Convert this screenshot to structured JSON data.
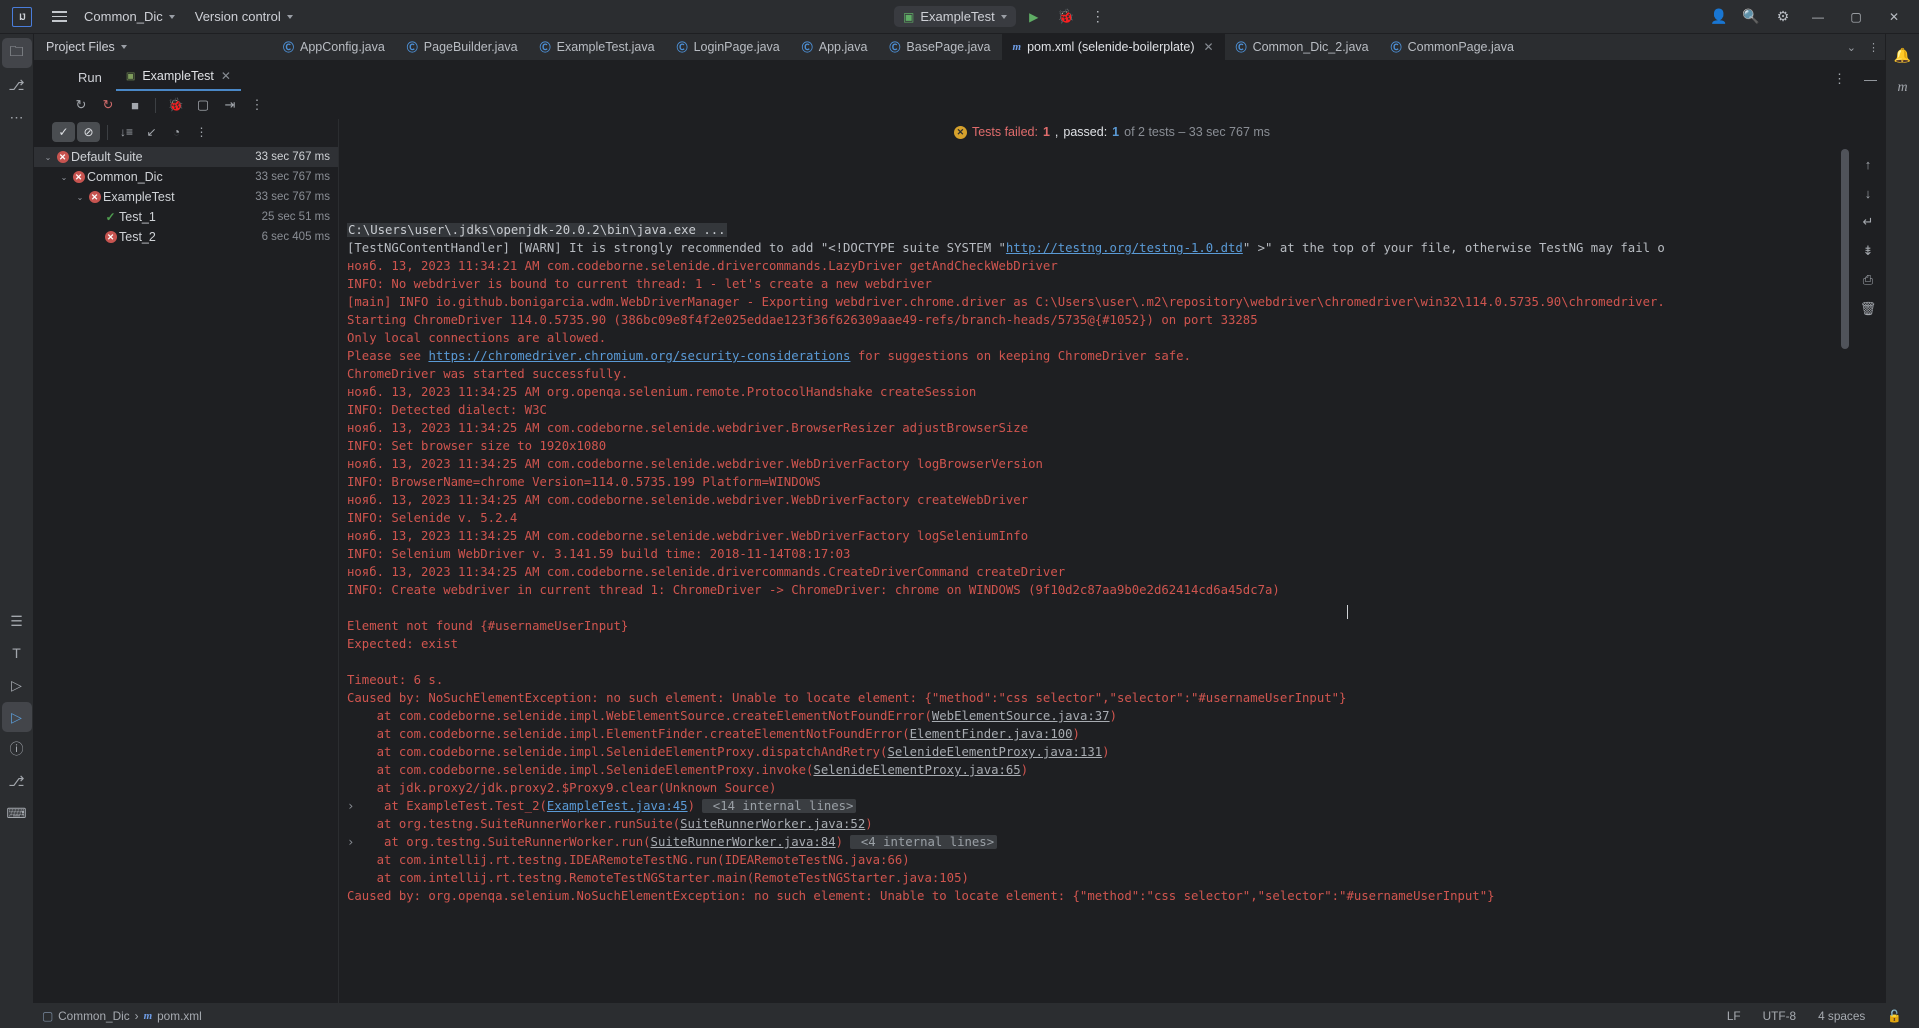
{
  "titlebar": {
    "logo": "IJ",
    "menu_icon": "hamburger-icon",
    "project": "Common_Dic",
    "vcs": "Version control",
    "run_config": "ExampleTest",
    "run_icon": "run-icon",
    "debug_icon": "debug-icon",
    "more_icon": "more-vertical-icon",
    "account_icon": "account-icon",
    "search_icon": "search-icon",
    "settings_icon": "gear-icon",
    "minimize": "minimize-icon",
    "maximize": "maximize-icon",
    "close": "close-icon"
  },
  "tabstrip": {
    "project_files": "Project Files",
    "tabs": [
      {
        "label": "AppConfig.java",
        "kind": "java",
        "active": false,
        "closable": false
      },
      {
        "label": "PageBuilder.java",
        "kind": "java",
        "active": false,
        "closable": false
      },
      {
        "label": "ExampleTest.java",
        "kind": "java",
        "active": false,
        "closable": false
      },
      {
        "label": "LoginPage.java",
        "kind": "java",
        "active": false,
        "closable": false
      },
      {
        "label": "App.java",
        "kind": "java",
        "active": false,
        "closable": false
      },
      {
        "label": "BasePage.java",
        "kind": "java",
        "active": false,
        "closable": false
      },
      {
        "label": "pom.xml (selenide-boilerplate)",
        "kind": "maven",
        "active": true,
        "closable": true
      },
      {
        "label": "Common_Dic_2.java",
        "kind": "java",
        "active": false,
        "closable": false
      },
      {
        "label": "CommonPage.java",
        "kind": "java",
        "active": false,
        "closable": false
      }
    ],
    "overflow": "chevron-down-icon"
  },
  "run_window": {
    "title": "Run",
    "tab_label": "ExampleTest",
    "tab_icon": "testng-icon",
    "tab_close": "close-icon",
    "options_icon": "more-vertical-icon",
    "hide_icon": "minimize-icon",
    "toolbar": [
      {
        "name": "rerun-button",
        "glyph": "↻"
      },
      {
        "name": "rerun-failed-tests-button",
        "glyph": "↻"
      },
      {
        "name": "stop-button",
        "glyph": "■"
      },
      {
        "name": "debug-button",
        "glyph": "🐞"
      },
      {
        "name": "screenshot-button",
        "glyph": "⬜"
      },
      {
        "name": "export-button",
        "glyph": "⇥"
      },
      {
        "name": "more-options-button",
        "glyph": "⋮"
      }
    ],
    "tree_toolbar": [
      {
        "name": "show-passed-toggle",
        "glyph": "✓",
        "pressed": true
      },
      {
        "name": "hide-ignored-toggle",
        "glyph": "⊘",
        "pressed": true
      },
      {
        "name": "sort-alphabetically-button",
        "glyph": "↓"
      },
      {
        "name": "collapse-all-button",
        "glyph": "↙"
      },
      {
        "name": "sort-by-duration-button",
        "glyph": "◷"
      },
      {
        "name": "tree-more-options-button",
        "glyph": "⋮"
      }
    ]
  },
  "test_tree": [
    {
      "label": "Default Suite",
      "time": "33 sec 767 ms",
      "status": "failed",
      "depth": 0,
      "expanded": true,
      "selected": true
    },
    {
      "label": "Common_Dic",
      "time": "33 sec 767 ms",
      "status": "failed",
      "depth": 1,
      "expanded": true,
      "selected": false
    },
    {
      "label": "ExampleTest",
      "time": "33 sec 767 ms",
      "status": "failed",
      "depth": 2,
      "expanded": true,
      "selected": false
    },
    {
      "label": "Test_1",
      "time": "25 sec 51 ms",
      "status": "passed",
      "depth": 3,
      "expanded": false,
      "selected": false
    },
    {
      "label": "Test_2",
      "time": "6 sec 405 ms",
      "status": "failed",
      "depth": 3,
      "expanded": false,
      "selected": false
    }
  ],
  "summary": {
    "icon": "warning-icon",
    "failed_label": "Tests failed: ",
    "failed_count": "1",
    "comma": ", ",
    "passed_label": "passed: ",
    "passed_count": "1",
    "tail": " of 2 tests – 33 sec 767 ms"
  },
  "console_lines": [
    {
      "t": "cmd",
      "text": "C:\\Users\\user\\.jdks\\openjdk-20.0.2\\bin\\java.exe ..."
    },
    {
      "t": "gray",
      "text": "[TestNGContentHandler] [WARN] It is strongly recommended to add \"<!DOCTYPE suite SYSTEM \"",
      "link": "http://testng.org/testng-1.0.dtd",
      "tail": "\" >\" at the top of your file, otherwise TestNG may fail o"
    },
    {
      "t": "red",
      "text": "нояб. 13, 2023 11:34:21 AM com.codeborne.selenide.drivercommands.LazyDriver getAndCheckWebDriver"
    },
    {
      "t": "red",
      "text": "INFO: No webdriver is bound to current thread: 1 - let's create a new webdriver"
    },
    {
      "t": "red",
      "text": "[main] INFO io.github.bonigarcia.wdm.WebDriverManager - Exporting webdriver.chrome.driver as C:\\Users\\user\\.m2\\repository\\webdriver\\chromedriver\\win32\\114.0.5735.90\\chromedriver."
    },
    {
      "t": "red",
      "text": "Starting ChromeDriver 114.0.5735.90 (386bc09e8f4f2e025eddae123f36f626309aae49-refs/branch-heads/5735@{#1052}) on port 33285"
    },
    {
      "t": "red",
      "text": "Only local connections are allowed."
    },
    {
      "t": "red",
      "text": "Please see ",
      "link": "https://chromedriver.chromium.org/security-considerations",
      "tail": " for suggestions on keeping ChromeDriver safe."
    },
    {
      "t": "red",
      "text": "ChromeDriver was started successfully."
    },
    {
      "t": "red",
      "text": "нояб. 13, 2023 11:34:25 AM org.openqa.selenium.remote.ProtocolHandshake createSession"
    },
    {
      "t": "red",
      "text": "INFO: Detected dialect: W3C"
    },
    {
      "t": "red",
      "text": "нояб. 13, 2023 11:34:25 AM com.codeborne.selenide.webdriver.BrowserResizer adjustBrowserSize"
    },
    {
      "t": "red",
      "text": "INFO: Set browser size to 1920x1080"
    },
    {
      "t": "red",
      "text": "нояб. 13, 2023 11:34:25 AM com.codeborne.selenide.webdriver.WebDriverFactory logBrowserVersion"
    },
    {
      "t": "red",
      "text": "INFO: BrowserName=chrome Version=114.0.5735.199 Platform=WINDOWS"
    },
    {
      "t": "red",
      "text": "нояб. 13, 2023 11:34:25 AM com.codeborne.selenide.webdriver.WebDriverFactory createWebDriver"
    },
    {
      "t": "red",
      "text": "INFO: Selenide v. 5.2.4"
    },
    {
      "t": "red",
      "text": "нояб. 13, 2023 11:34:25 AM com.codeborne.selenide.webdriver.WebDriverFactory logSeleniumInfo"
    },
    {
      "t": "red",
      "text": "INFO: Selenium WebDriver v. 3.141.59 build time: 2018-11-14T08:17:03"
    },
    {
      "t": "red",
      "text": "нояб. 13, 2023 11:34:25 AM com.codeborne.selenide.drivercommands.CreateDriverCommand createDriver"
    },
    {
      "t": "red",
      "text": "INFO: Create webdriver in current thread 1: ChromeDriver -> ChromeDriver: chrome on WINDOWS (9f10d2c87aa9b0e2d62414cd6a45dc7a)"
    },
    {
      "t": "red",
      "text": ""
    },
    {
      "t": "red",
      "text": "Element not found {#usernameUserInput}"
    },
    {
      "t": "red",
      "text": "Expected: exist"
    },
    {
      "t": "red",
      "text": ""
    },
    {
      "t": "red",
      "text": "Timeout: 6 s."
    },
    {
      "t": "red",
      "text": "Caused by: NoSuchElementException: no such element: Unable to locate element: {\"method\":\"css selector\",\"selector\":\"#usernameUserInput\"}"
    },
    {
      "t": "red",
      "text": "    at com.codeborne.selenide.impl.WebElementSource.createElementNotFoundError(",
      "link_gray": "WebElementSource.java:37",
      "tail": ")"
    },
    {
      "t": "red",
      "text": "    at com.codeborne.selenide.impl.ElementFinder.createElementNotFoundError(",
      "link_gray": "ElementFinder.java:100",
      "tail": ")"
    },
    {
      "t": "red",
      "text": "    at com.codeborne.selenide.impl.SelenideElementProxy.dispatchAndRetry(",
      "link_gray": "SelenideElementProxy.java:131",
      "tail": ")"
    },
    {
      "t": "red",
      "text": "    at com.codeborne.selenide.impl.SelenideElementProxy.invoke(",
      "link_gray": "SelenideElementProxy.java:65",
      "tail": ")"
    },
    {
      "t": "red",
      "text": "    at jdk.proxy2/jdk.proxy2.$Proxy9.clear(Unknown Source)"
    },
    {
      "t": "red",
      "text": "    at ExampleTest.Test_2(",
      "link_blue": "ExampleTest.java:45",
      "tail": ")",
      "internal": "<14 internal lines>",
      "fold": true
    },
    {
      "t": "red",
      "text": "    at org.testng.SuiteRunnerWorker.runSuite(",
      "link_gray": "SuiteRunnerWorker.java:52",
      "tail": ")"
    },
    {
      "t": "red",
      "text": "    at org.testng.SuiteRunnerWorker.run(",
      "link_gray": "SuiteRunnerWorker.java:84",
      "tail": ")",
      "internal": "<4 internal lines>",
      "fold": true
    },
    {
      "t": "red",
      "text": "    at com.intellij.rt.testng.IDEARemoteTestNG.run(IDEARemoteTestNG.java:66)"
    },
    {
      "t": "red",
      "text": "    at com.intellij.rt.testng.RemoteTestNGStarter.main(RemoteTestNGStarter.java:105)"
    },
    {
      "t": "red",
      "text": "Caused by: org.openqa.selenium.NoSuchElementException: no such element: Unable to locate element: {\"method\":\"css selector\",\"selector\":\"#usernameUserInput\"}"
    }
  ],
  "console_gutter": [
    {
      "name": "scroll-up-button",
      "glyph": "↑"
    },
    {
      "name": "scroll-down-button",
      "glyph": "↓"
    },
    {
      "name": "soft-wrap-button",
      "glyph": "↵"
    },
    {
      "name": "scroll-to-end-button",
      "glyph": "↧"
    },
    {
      "name": "print-button",
      "glyph": "⎙"
    },
    {
      "name": "clear-all-button",
      "glyph": "🗑"
    }
  ],
  "left_rail": [
    {
      "name": "project-tool-button",
      "glyph": "🗀",
      "selected": true
    },
    {
      "name": "commit-tool-button",
      "glyph": "⎇",
      "selected": false
    },
    {
      "name": "more-tool-windows-button",
      "glyph": "⋯",
      "selected": false
    },
    {
      "name": "structure-tool-button",
      "glyph": "☰",
      "selected": false
    },
    {
      "name": "terminal-tool-button",
      "glyph": "T",
      "selected": false
    },
    {
      "name": "services-tool-button",
      "glyph": "▷",
      "selected": false
    },
    {
      "name": "run-tool-button",
      "glyph": "▷",
      "selected": true
    },
    {
      "name": "problems-tool-button",
      "glyph": "ⓘ",
      "selected": false
    },
    {
      "name": "git-tool-button",
      "glyph": "⎇",
      "selected": false
    },
    {
      "name": "terminal-bottom-button",
      "glyph": "⌨",
      "selected": false
    }
  ],
  "right_rail": [
    {
      "name": "notifications-button",
      "glyph": "🔔"
    },
    {
      "name": "maven-tool-button",
      "glyph": "m"
    }
  ],
  "statusbar": {
    "crumb_project": "Common_Dic",
    "crumb_sep": "›",
    "crumb_file": "pom.xml",
    "crumb_icon": "maven-icon",
    "line_sep": "LF",
    "encoding": "UTF-8",
    "indent": "4 spaces",
    "lock_icon": "lock-icon"
  },
  "colors": {
    "accent_blue": "#4a88c7",
    "error_red": "#c75450",
    "pass_green": "#4f9c4f",
    "warn_yellow": "#d6a12c",
    "bg": "#1e1f22",
    "panel": "#2b2d30"
  }
}
